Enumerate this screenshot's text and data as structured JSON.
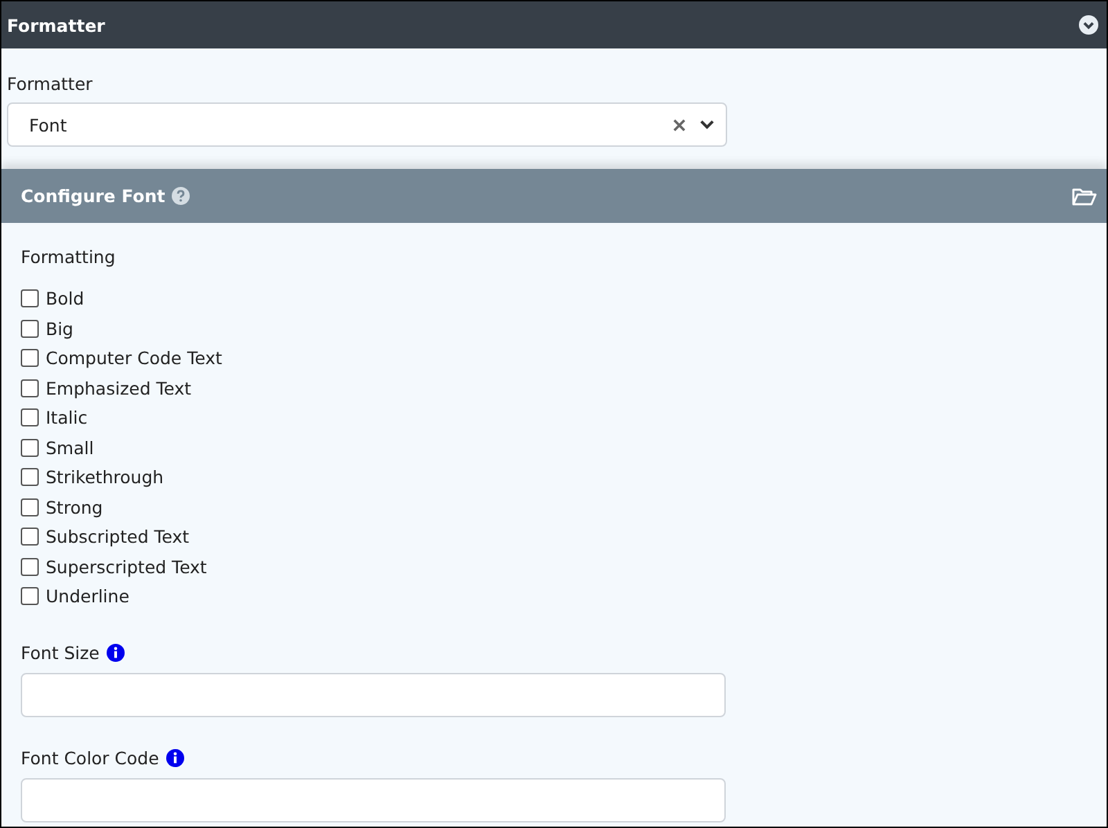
{
  "panel": {
    "title": "Formatter"
  },
  "formatter": {
    "label": "Formatter",
    "value": "Font"
  },
  "configure": {
    "title": "Configure Font",
    "group_label": "Formatting",
    "options": [
      {
        "label": "Bold",
        "checked": false
      },
      {
        "label": "Big",
        "checked": false
      },
      {
        "label": "Computer Code Text",
        "checked": false
      },
      {
        "label": "Emphasized Text",
        "checked": false
      },
      {
        "label": "Italic",
        "checked": false
      },
      {
        "label": "Small",
        "checked": false
      },
      {
        "label": "Strikethrough",
        "checked": false
      },
      {
        "label": "Strong",
        "checked": false
      },
      {
        "label": "Subscripted Text",
        "checked": false
      },
      {
        "label": "Superscripted Text",
        "checked": false
      },
      {
        "label": "Underline",
        "checked": false
      }
    ],
    "fields": [
      {
        "label": "Font Size"
      },
      {
        "label": "Font Color Code"
      }
    ]
  }
}
